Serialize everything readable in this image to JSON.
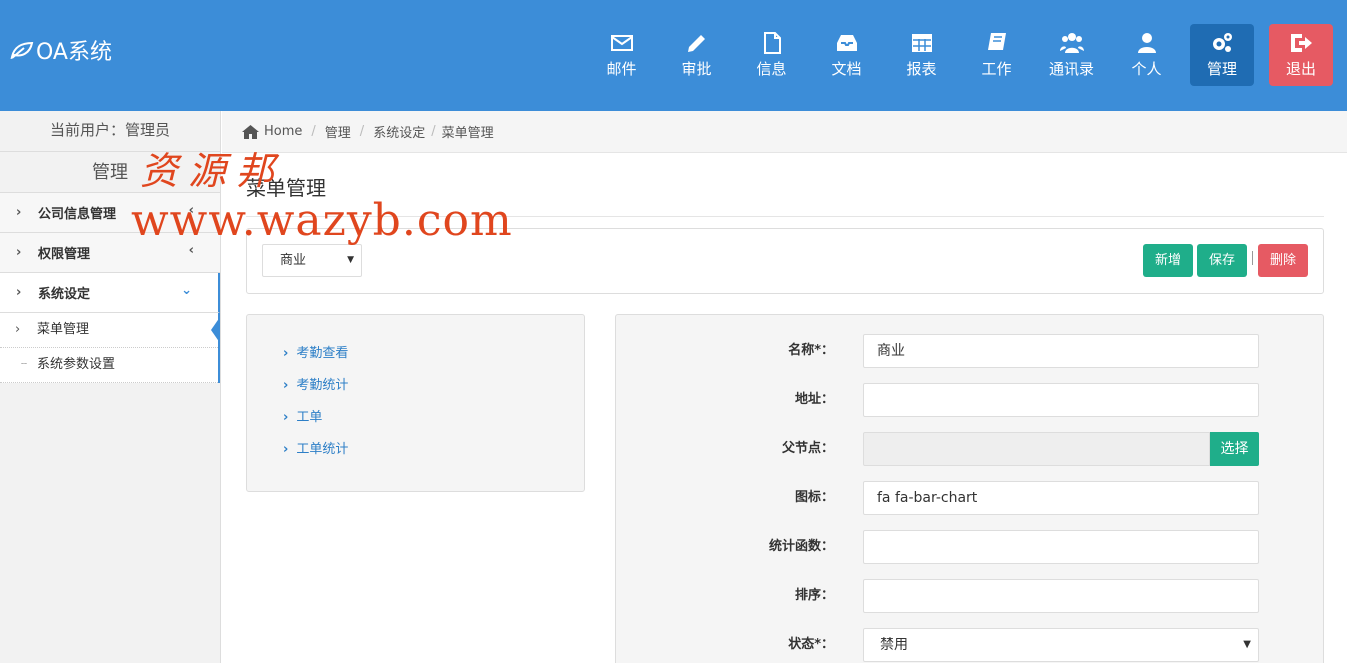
{
  "app": {
    "logo_text": "OA系统"
  },
  "nav": [
    {
      "label": "邮件",
      "icon": "envelope-icon"
    },
    {
      "label": "审批",
      "icon": "pencil-icon"
    },
    {
      "label": "信息",
      "icon": "file-icon"
    },
    {
      "label": "文档",
      "icon": "inbox-icon"
    },
    {
      "label": "报表",
      "icon": "table-icon"
    },
    {
      "label": "工作",
      "icon": "book-icon"
    },
    {
      "label": "通讯录",
      "icon": "users-icon"
    },
    {
      "label": "个人",
      "icon": "user-icon"
    },
    {
      "label": "管理",
      "icon": "gears-icon"
    },
    {
      "label": "退出",
      "icon": "sign-out-icon"
    }
  ],
  "sidebar": {
    "current_user": "当前用户：管理员",
    "title": "管理",
    "groups": [
      {
        "label": "公司信息管理"
      },
      {
        "label": "权限管理"
      },
      {
        "label": "系统设定"
      }
    ],
    "sub_items": [
      {
        "label": "菜单管理"
      },
      {
        "label": "系统参数设置"
      }
    ]
  },
  "breadcrumb": {
    "home": "Home",
    "items": [
      "管理",
      "系统设定",
      "菜单管理"
    ]
  },
  "page": {
    "title": "菜单管理"
  },
  "toolbar": {
    "select_value": "商业",
    "add": "新增",
    "save": "保存",
    "delete": "删除"
  },
  "tree": [
    "考勤查看",
    "考勤统计",
    "工单",
    "工单统计"
  ],
  "form": {
    "name_label": "名称*：",
    "name_value": "商业",
    "url_label": "地址：",
    "url_value": "",
    "parent_label": "父节点：",
    "parent_value": "",
    "choose": "选择",
    "icon_label": "图标：",
    "icon_value": "fa fa-bar-chart",
    "func_label": "统计函数：",
    "func_value": "",
    "order_label": "排序：",
    "order_value": "",
    "status_label": "状态*：",
    "status_value": "禁用"
  },
  "watermark": {
    "line1": "资源邦",
    "line2": "www.wazyb.com"
  },
  "colors": {
    "topbar": "#3c8dd8",
    "active": "#1f6cb3",
    "danger": "#e65a63",
    "success": "#1fae8a"
  }
}
